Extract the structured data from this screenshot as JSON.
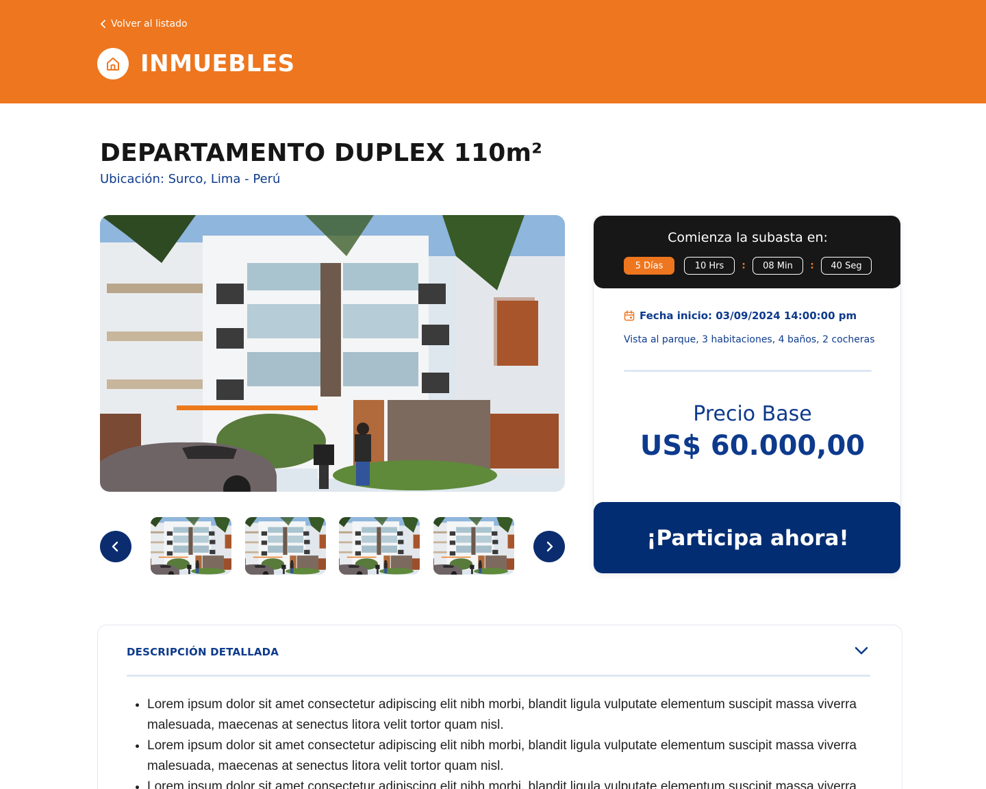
{
  "header": {
    "back_label": "Volver al listado",
    "brand": "INMUEBLES",
    "color": "#ee761e"
  },
  "property": {
    "title": "DEPARTAMENTO DUPLEX 110m²",
    "location": "Ubicación: Surco, Lima - Perú"
  },
  "gallery": {
    "thumbnail_count": 4,
    "prev_icon": "chevron-left-icon",
    "next_icon": "chevron-right-icon"
  },
  "auction": {
    "starts_label": "Comienza la subasta en:",
    "timer": {
      "days": "5 Días",
      "hours": "10 Hrs",
      "minutes": "08 Min",
      "seconds": "40 Seg"
    },
    "fecha": "Fecha inicio: 03/09/2024 14:00:00 pm",
    "features": "Vista al parque, 3 habitaciones, 4 baños, 2 cocheras",
    "price_label": "Precio Base",
    "price_value": "US$ 60.000,00",
    "cta": "¡Participa ahora!"
  },
  "description": {
    "title": "DESCRIPCIÓN DETALLADA",
    "items": [
      "Lorem ipsum dolor sit amet consectetur adipiscing elit nibh morbi, blandit ligula vulputate elementum suscipit massa viverra malesuada, maecenas at senectus litora velit tortor quam nisl.",
      "Lorem ipsum dolor sit amet consectetur adipiscing elit nibh morbi, blandit ligula vulputate elementum suscipit massa viverra malesuada, maecenas at senectus litora velit tortor quam nisl.",
      "Lorem ipsum dolor sit amet consectetur adipiscing elit nibh morbi, blandit ligula vulputate elementum suscipit massa viverra malesuada, maecenas at senectus litora velit tortor quam nisl."
    ]
  },
  "colors": {
    "accent": "#ee761e",
    "navy": "#022d72",
    "text_blue": "#0d3a8c",
    "dark": "#171717"
  }
}
